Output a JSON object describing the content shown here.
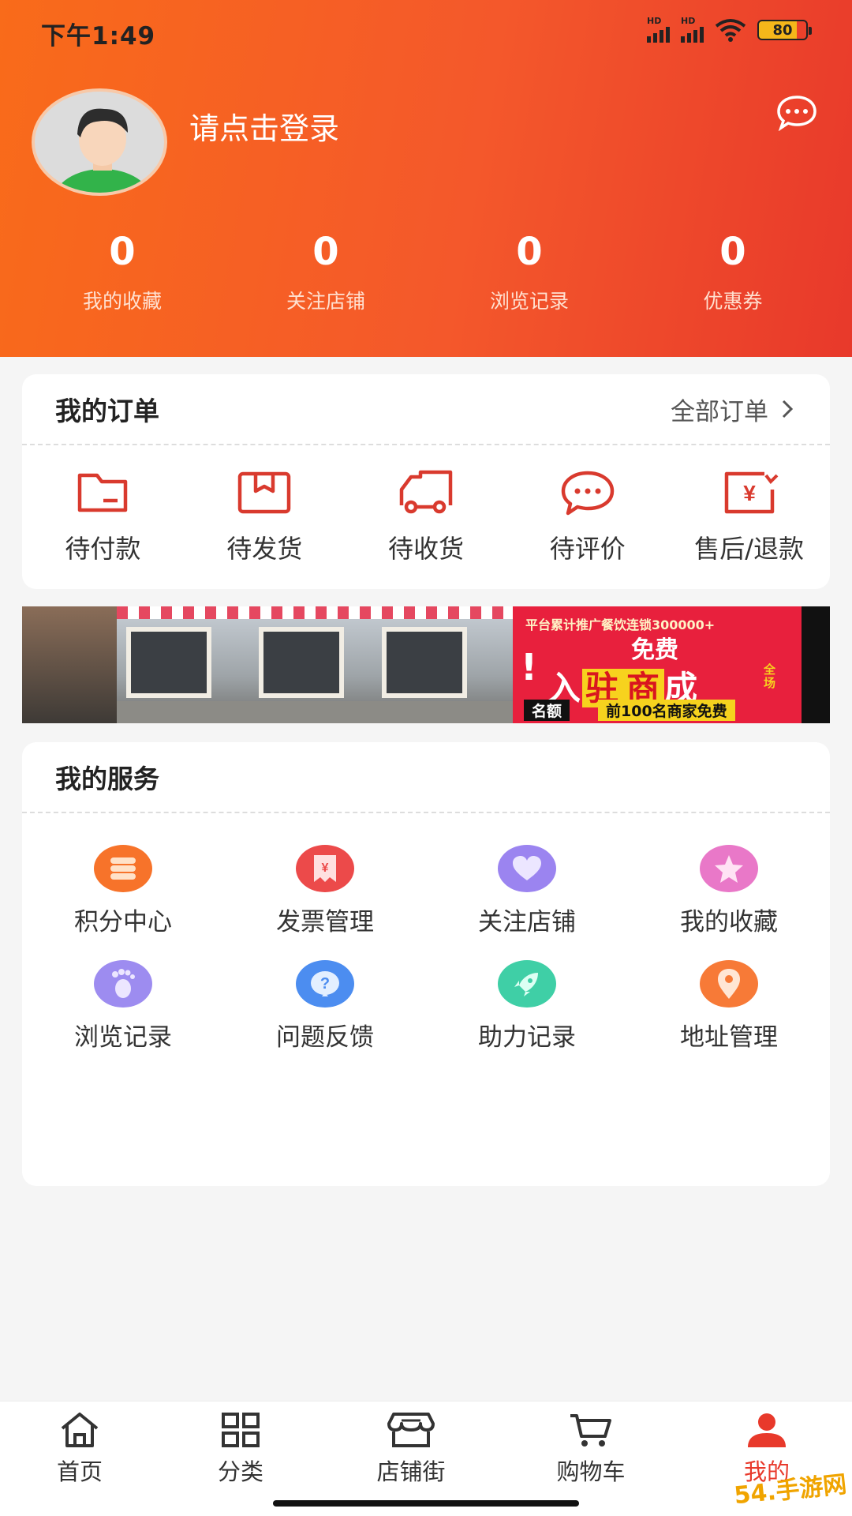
{
  "status_bar": {
    "time": "下午1:49",
    "network_1": "HD",
    "network_2": "HD",
    "battery": "80"
  },
  "header": {
    "login_text": "请点击登录",
    "stats": [
      {
        "value": "0",
        "label": "我的收藏"
      },
      {
        "value": "0",
        "label": "关注店铺"
      },
      {
        "value": "0",
        "label": "浏览记录"
      },
      {
        "value": "0",
        "label": "优惠券"
      }
    ]
  },
  "orders": {
    "title": "我的订单",
    "all_link": "全部订单",
    "items": [
      {
        "label": "待付款",
        "icon": "wallet-icon"
      },
      {
        "label": "待发货",
        "icon": "box-icon"
      },
      {
        "label": "待收货",
        "icon": "truck-icon"
      },
      {
        "label": "待评价",
        "icon": "comment-icon"
      },
      {
        "label": "售后/退款",
        "icon": "refund-icon"
      }
    ]
  },
  "banner": {
    "top": "平台累计推广餐饮连锁300000+",
    "free": "免费",
    "main_1": "入",
    "main_2": "驻",
    "main_3": "商",
    "main_4": "成",
    "side": "全场",
    "quota": "名额",
    "bottom": "前100名商家免费"
  },
  "services": {
    "title": "我的服务",
    "items": [
      {
        "label": "积分中心",
        "icon": "coins-icon",
        "color": "#f7732a"
      },
      {
        "label": "发票管理",
        "icon": "invoice-icon",
        "color": "#ec4a4a"
      },
      {
        "label": "关注店铺",
        "icon": "heart-icon",
        "color": "#9b84f0"
      },
      {
        "label": "我的收藏",
        "icon": "star-icon",
        "color": "#e978c8"
      },
      {
        "label": "浏览记录",
        "icon": "footprint-icon",
        "color": "#9d8cf0"
      },
      {
        "label": "问题反馈",
        "icon": "question-icon",
        "color": "#4c8df0"
      },
      {
        "label": "助力记录",
        "icon": "rocket-icon",
        "color": "#3fcfa6"
      },
      {
        "label": "地址管理",
        "icon": "location-icon",
        "color": "#f77a37"
      }
    ]
  },
  "tabbar": {
    "items": [
      {
        "label": "首页",
        "icon": "home-icon"
      },
      {
        "label": "分类",
        "icon": "grid-icon"
      },
      {
        "label": "店铺街",
        "icon": "store-icon"
      },
      {
        "label": "购物车",
        "icon": "cart-icon"
      },
      {
        "label": "我的",
        "icon": "user-icon"
      }
    ],
    "active_color": "#e8392b"
  },
  "watermark": "54.手游网"
}
